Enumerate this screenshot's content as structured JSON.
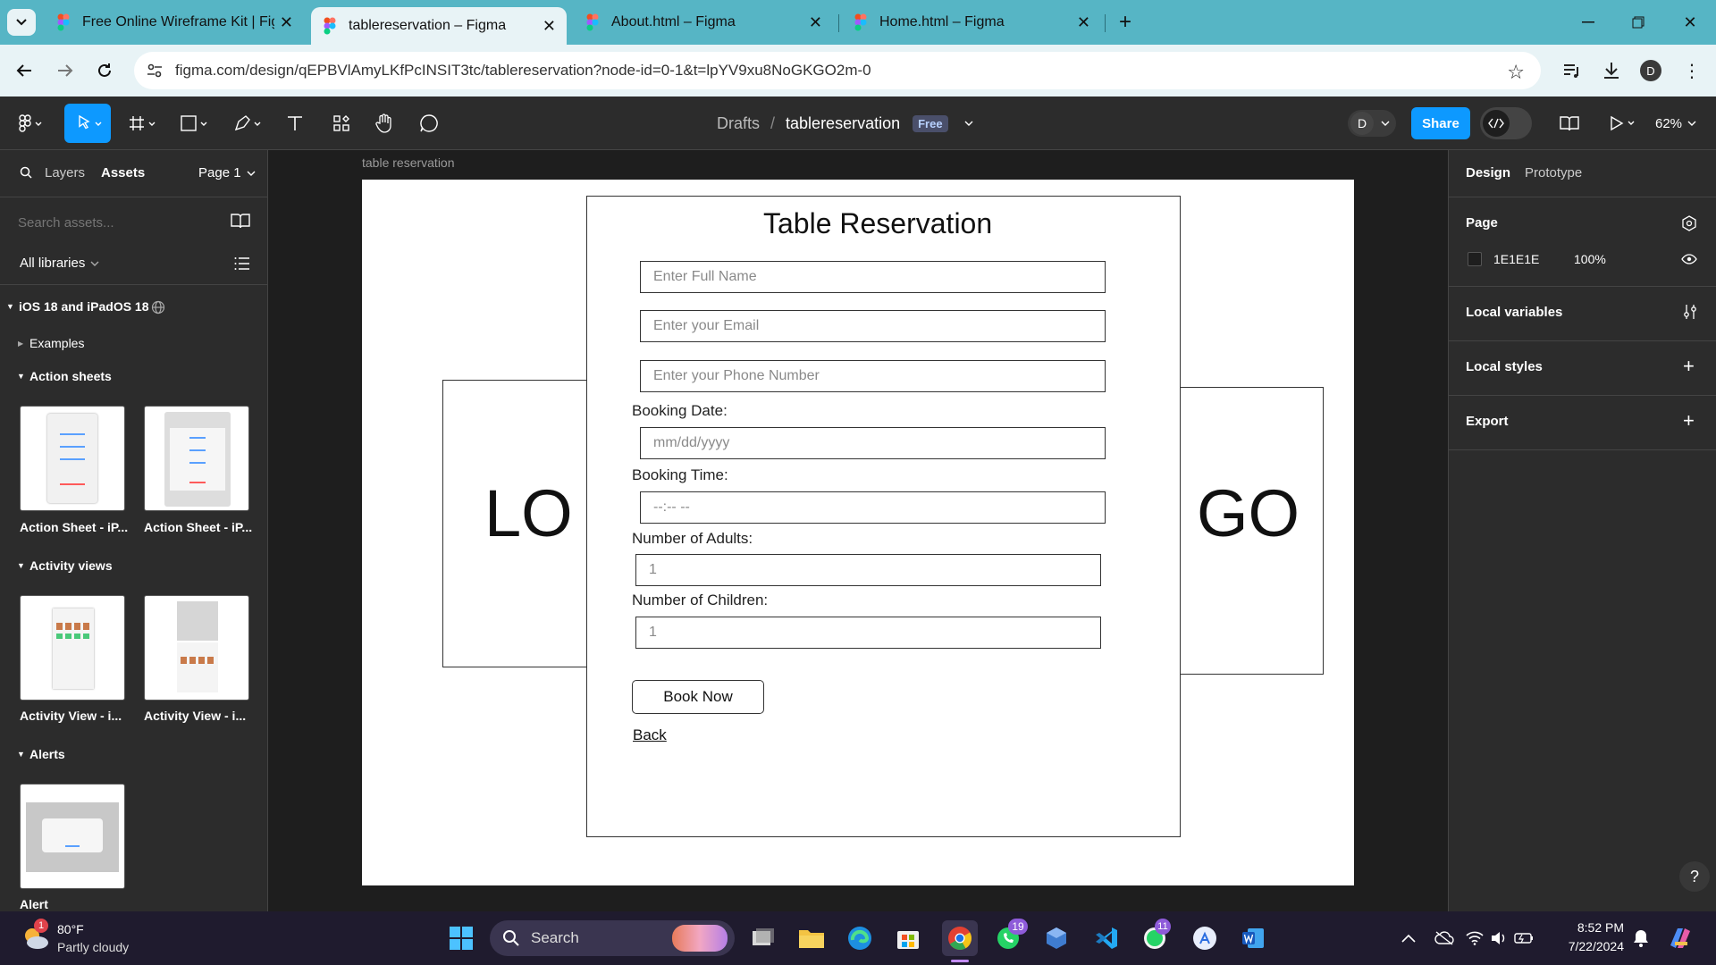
{
  "browser": {
    "tabs": [
      {
        "title": "Free Online Wireframe Kit | Fig",
        "active": false
      },
      {
        "title": "tablereservation – Figma",
        "active": true
      },
      {
        "title": "About.html – Figma",
        "active": false
      },
      {
        "title": "Home.html – Figma",
        "active": false
      }
    ],
    "url": "figma.com/design/qEPBVlAmyLKfPcINSIT3tc/tablereservation?node-id=0-1&t=lpYV9xu8NoGKGO2m-0",
    "profile_initial": "D"
  },
  "toolbar": {
    "breadcrumb_drafts": "Drafts",
    "breadcrumb_sep": "/",
    "file_name": "tablereservation",
    "plan_badge": "Free",
    "user_initial": "D",
    "share_label": "Share",
    "zoom": "62%"
  },
  "left_panel": {
    "tab_layers": "Layers",
    "tab_assets": "Assets",
    "page_selector": "Page 1",
    "search_placeholder": "Search assets...",
    "libraries": "All libraries",
    "library_name": "iOS 18 and iPadOS 18",
    "sections": {
      "examples": "Examples",
      "action_sheets": "Action sheets",
      "activity_views": "Activity views",
      "alerts": "Alerts"
    },
    "thumbs": {
      "action_sheet_1": "Action Sheet - iP...",
      "action_sheet_2": "Action Sheet - iP...",
      "activity_view_1": "Activity View - i...",
      "activity_view_2": "Activity View - i...",
      "alert": "Alert"
    }
  },
  "canvas": {
    "frame_label": "table reservation",
    "form": {
      "title": "Table Reservation",
      "full_name_placeholder": "Enter Full Name",
      "email_placeholder": "Enter your Email",
      "phone_placeholder": "Enter your Phone Number",
      "booking_date_label": "Booking Date:",
      "booking_date_placeholder": "mm/dd/yyyy",
      "booking_time_label": "Booking Time:",
      "booking_time_placeholder": "--:-- --",
      "adults_label": "Number of Adults:",
      "adults_value": "1",
      "children_label": "Number of Children:",
      "children_value": "1",
      "book_button": "Book Now",
      "back_link": "Back"
    },
    "logo_left": "LO",
    "logo_right": "GO"
  },
  "right_panel": {
    "tab_design": "Design",
    "tab_prototype": "Prototype",
    "page_title": "Page",
    "page_color": "1E1E1E",
    "page_opacity": "100%",
    "local_variables": "Local variables",
    "local_styles": "Local styles",
    "export": "Export",
    "colors": {
      "swatch": "#1e1e1e"
    }
  },
  "taskbar": {
    "weather_temp": "80°F",
    "weather_desc": "Partly cloudy",
    "weather_badge": "1",
    "search_label": "Search",
    "whatsapp_badge": "19",
    "whatsapp2_badge": "11",
    "time": "8:52 PM",
    "date": "7/22/2024"
  },
  "colors": {
    "browser_tabs_bg": "#56b5c5",
    "figma_blue": "#0d99ff",
    "panel_bg": "#2c2c2c",
    "canvas_bg": "#1e1e1e"
  }
}
